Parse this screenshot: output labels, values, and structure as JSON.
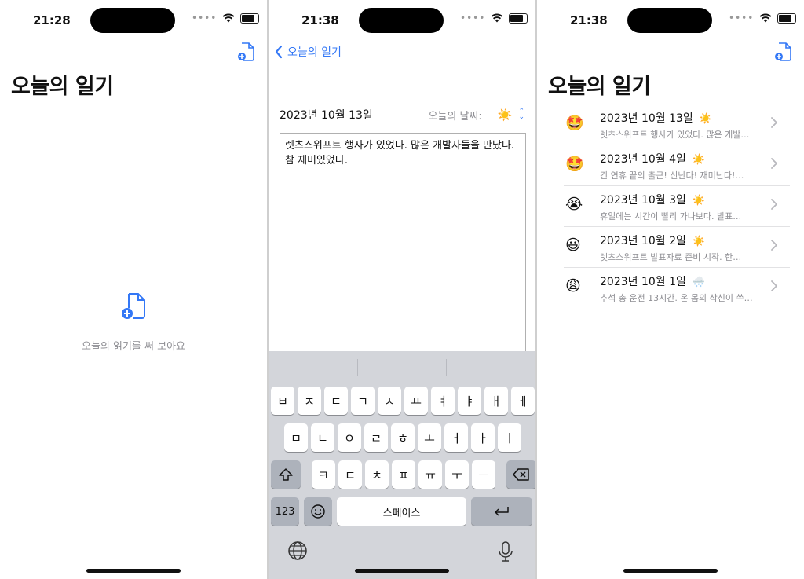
{
  "screen1": {
    "time": "21:28",
    "title": "오늘의 일기",
    "empty_text": "오늘의 읽기를 써 보아요",
    "add_icon": "doc-plus-icon",
    "empty_icon": "doc-plus-icon"
  },
  "screen2": {
    "time": "21:38",
    "back_label": "오늘의 일기",
    "date": "2023년 10월 13일",
    "weather_label": "오늘의 날씨:",
    "weather_value": "☀️",
    "entry_text": "렛츠스위프트 행사가 있었다. 많은 개발자들을 만났다. 참 재미있었다.",
    "keyboard": {
      "row1": [
        "ㅂ",
        "ㅈ",
        "ㄷ",
        "ㄱ",
        "ㅅ",
        "ㅛ",
        "ㅕ",
        "ㅑ",
        "ㅐ",
        "ㅔ"
      ],
      "row2": [
        "ㅁ",
        "ㄴ",
        "ㅇ",
        "ㄹ",
        "ㅎ",
        "ㅗ",
        "ㅓ",
        "ㅏ",
        "ㅣ"
      ],
      "row3": [
        "ㅋ",
        "ㅌ",
        "ㅊ",
        "ㅍ",
        "ㅠ",
        "ㅜ",
        "ㅡ"
      ],
      "num_label": "123",
      "space_label": "스페이스"
    }
  },
  "screen3": {
    "time": "21:38",
    "title": "오늘의 일기",
    "entries": [
      {
        "emoji": "🤩",
        "date": "2023년 10월 13일",
        "weather": "☀️",
        "preview": "렛츠스위프트 행사가 있었다. 많은 개발…"
      },
      {
        "emoji": "🤩",
        "date": "2023년 10월 4일",
        "weather": "☀️",
        "preview": "긴 연휴 끝의 출근! 신난다! 재미난다!…"
      },
      {
        "emoji": "😭",
        "date": "2023년 10월 3일",
        "weather": "☀️",
        "preview": "휴일에는 시간이 빨리 가나보다. 발표…"
      },
      {
        "emoji": "😃",
        "date": "2023년 10월 2일",
        "weather": "☀️",
        "preview": "렛츠스위프트 발표자료 준비 시작. 한…"
      },
      {
        "emoji": "😩",
        "date": "2023년 10월 1일",
        "weather": "🌨️",
        "preview": "추석 총 운전 13시간. 온 몸의 삭신이 쑤…"
      }
    ]
  },
  "colors": {
    "accent": "#3478f6",
    "secondary_text": "#8e8e93",
    "keyboard_bg": "#d3d5da"
  }
}
